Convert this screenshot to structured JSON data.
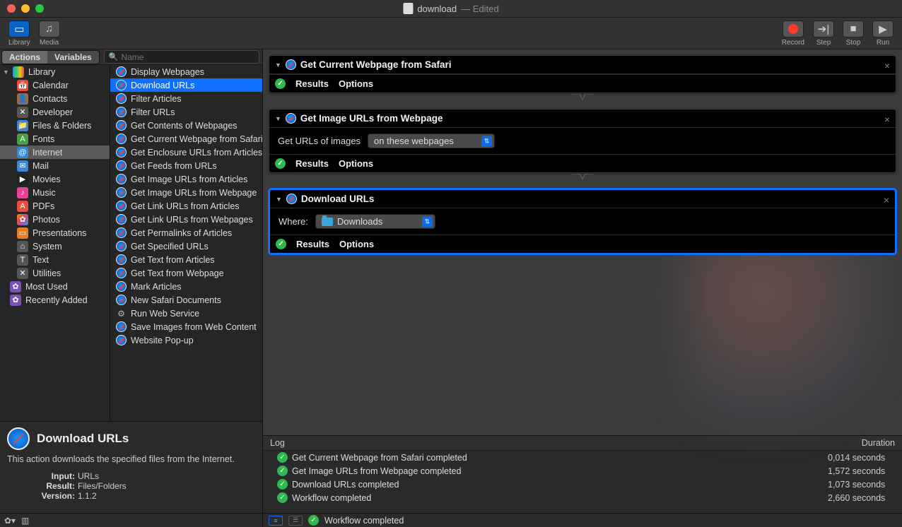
{
  "window": {
    "title": "download",
    "edited": "— Edited"
  },
  "toolbar": {
    "library": "Library",
    "media": "Media",
    "record": "Record",
    "step": "Step",
    "stop": "Stop",
    "run": "Run"
  },
  "sidebar": {
    "tab_actions": "Actions",
    "tab_variables": "Variables",
    "search_placeholder": "Name",
    "root": "Library",
    "categories": [
      {
        "label": "Calendar",
        "ic": "ic-cal",
        "g": "📅"
      },
      {
        "label": "Contacts",
        "ic": "ic-con",
        "g": "👤"
      },
      {
        "label": "Developer",
        "ic": "ic-dev",
        "g": "✕"
      },
      {
        "label": "Files & Folders",
        "ic": "ic-fol",
        "g": "📁"
      },
      {
        "label": "Fonts",
        "ic": "ic-fon",
        "g": "A"
      },
      {
        "label": "Internet",
        "ic": "ic-int",
        "g": "@",
        "sel": true
      },
      {
        "label": "Mail",
        "ic": "ic-mai",
        "g": "✉"
      },
      {
        "label": "Movies",
        "ic": "ic-mov",
        "g": "▶"
      },
      {
        "label": "Music",
        "ic": "ic-mus",
        "g": "♪"
      },
      {
        "label": "PDFs",
        "ic": "ic-pdf",
        "g": "A"
      },
      {
        "label": "Photos",
        "ic": "ic-pho",
        "g": "✿"
      },
      {
        "label": "Presentations",
        "ic": "ic-pre",
        "g": "▭"
      },
      {
        "label": "System",
        "ic": "ic-sys",
        "g": "⌂"
      },
      {
        "label": "Text",
        "ic": "ic-txt",
        "g": "T"
      },
      {
        "label": "Utilities",
        "ic": "ic-uti",
        "g": "✕"
      }
    ],
    "most_used": "Most Used",
    "recently_added": "Recently Added",
    "actions": [
      "Display Webpages",
      "Download URLs",
      "Filter Articles",
      "Filter URLs",
      "Get Contents of Webpages",
      "Get Current Webpage from Safari",
      "Get Enclosure URLs from Articles",
      "Get Feeds from URLs",
      "Get Image URLs from Articles",
      "Get Image URLs from Webpage",
      "Get Link URLs from Articles",
      "Get Link URLs from Webpages",
      "Get Permalinks of Articles",
      "Get Specified URLs",
      "Get Text from Articles",
      "Get Text from Webpage",
      "Mark Articles",
      "New Safari Documents",
      "Run Web Service",
      "Save Images from Web Content",
      "Website Pop-up"
    ],
    "selected_action_index": 1,
    "gear_action_index": 18
  },
  "info": {
    "title": "Download URLs",
    "desc": "This action downloads the specified files from the Internet.",
    "rows": [
      {
        "label": "Input:",
        "val": "URLs"
      },
      {
        "label": "Result:",
        "val": "Files/Folders"
      },
      {
        "label": "Version:",
        "val": "1.1.2"
      }
    ]
  },
  "workflow": {
    "steps": [
      {
        "title": "Get Current Webpage from Safari",
        "body": null,
        "results": "Results",
        "options": "Options"
      },
      {
        "title": "Get Image URLs from Webpage",
        "body_label": "Get URLs of images",
        "popup": "on these webpages",
        "results": "Results",
        "options": "Options"
      },
      {
        "title": "Download URLs",
        "where_label": "Where:",
        "where_value": "Downloads",
        "results": "Results",
        "options": "Options",
        "selected": true
      }
    ]
  },
  "log": {
    "header_log": "Log",
    "header_dur": "Duration",
    "rows": [
      {
        "msg": "Get Current Webpage from Safari completed",
        "dur": "0,014 seconds"
      },
      {
        "msg": "Get Image URLs from Webpage completed",
        "dur": "1,572 seconds"
      },
      {
        "msg": "Download URLs completed",
        "dur": "1,073 seconds"
      },
      {
        "msg": "Workflow completed",
        "dur": "2,660 seconds"
      }
    ]
  },
  "footer": {
    "status": "Workflow completed"
  }
}
